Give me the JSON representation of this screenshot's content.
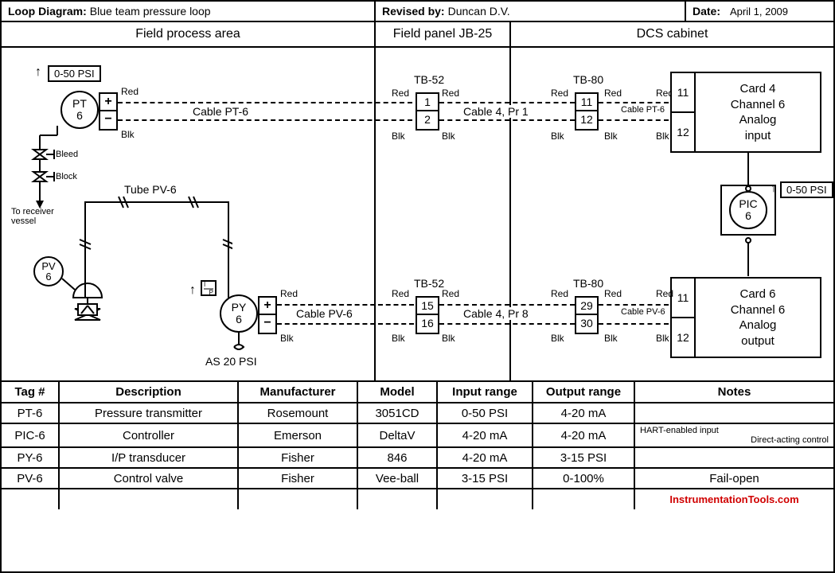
{
  "header": {
    "loop_label": "Loop Diagram:",
    "loop_title": "Blue team pressure loop",
    "rev_label": "Revised by:",
    "rev_value": "Duncan D.V.",
    "date_label": "Date:",
    "date_value": "April 1, 2009"
  },
  "areas": {
    "field": "Field process area",
    "panel": "Field panel JB-25",
    "dcs": "DCS cabinet"
  },
  "diagram": {
    "pt_range": "0-50 PSI",
    "pt_tag_a": "PT",
    "pt_tag_b": "6",
    "pv_tag_a": "PV",
    "pv_tag_b": "6",
    "py_tag_a": "PY",
    "py_tag_b": "6",
    "pic_tag_a": "PIC",
    "pic_tag_b": "6",
    "pic_range": "0-50 PSI",
    "bleed": "Bleed",
    "block": "Block",
    "to_recv1": "To receiver",
    "to_recv2": "vessel",
    "tube": "Tube PV-6",
    "ip": "I",
    "ip2": "P",
    "as": "AS 20 PSI",
    "cable_pt6": "Cable PT-6",
    "cable_pv6": "Cable PV-6",
    "cable4_pr1": "Cable 4, Pr 1",
    "cable4_pr8": "Cable 4, Pr 8",
    "tb52": "TB-52",
    "tb80": "TB-80",
    "red": "Red",
    "blk": "Blk",
    "plus": "+",
    "minus": "−",
    "tb52_top": {
      "t1": "1",
      "t2": "2"
    },
    "tb52_bot": {
      "t1": "15",
      "t2": "16"
    },
    "tb80_top": {
      "t1": "11",
      "t2": "12"
    },
    "tb80_bot": {
      "t1": "29",
      "t2": "30"
    },
    "card_in": {
      "term1": "11",
      "term2": "12",
      "l1": "Card 4",
      "l2": "Channel 6",
      "l3": "Analog",
      "l4": "input"
    },
    "card_out": {
      "term1": "11",
      "term2": "12",
      "l1": "Card 6",
      "l2": "Channel 6",
      "l3": "Analog",
      "l4": "output"
    }
  },
  "table": {
    "headers": [
      "Tag #",
      "Description",
      "Manufacturer",
      "Model",
      "Input range",
      "Output range",
      "Notes"
    ],
    "rows": [
      [
        "PT-6",
        "Pressure transmitter",
        "Rosemount",
        "3051CD",
        "0-50 PSI",
        "4-20 mA",
        ""
      ],
      [
        "PIC-6",
        "Controller",
        "Emerson",
        "DeltaV",
        "4-20 mA",
        "4-20 mA",
        "HART-enabled input\nDirect-acting control"
      ],
      [
        "PY-6",
        "I/P transducer",
        "Fisher",
        "846",
        "4-20 mA",
        "3-15 PSI",
        ""
      ],
      [
        "PV-6",
        "Control valve",
        "Fisher",
        "Vee-ball",
        "3-15 PSI",
        "0-100%",
        "Fail-open"
      ]
    ]
  },
  "watermark": "InstrumentationTools.com"
}
